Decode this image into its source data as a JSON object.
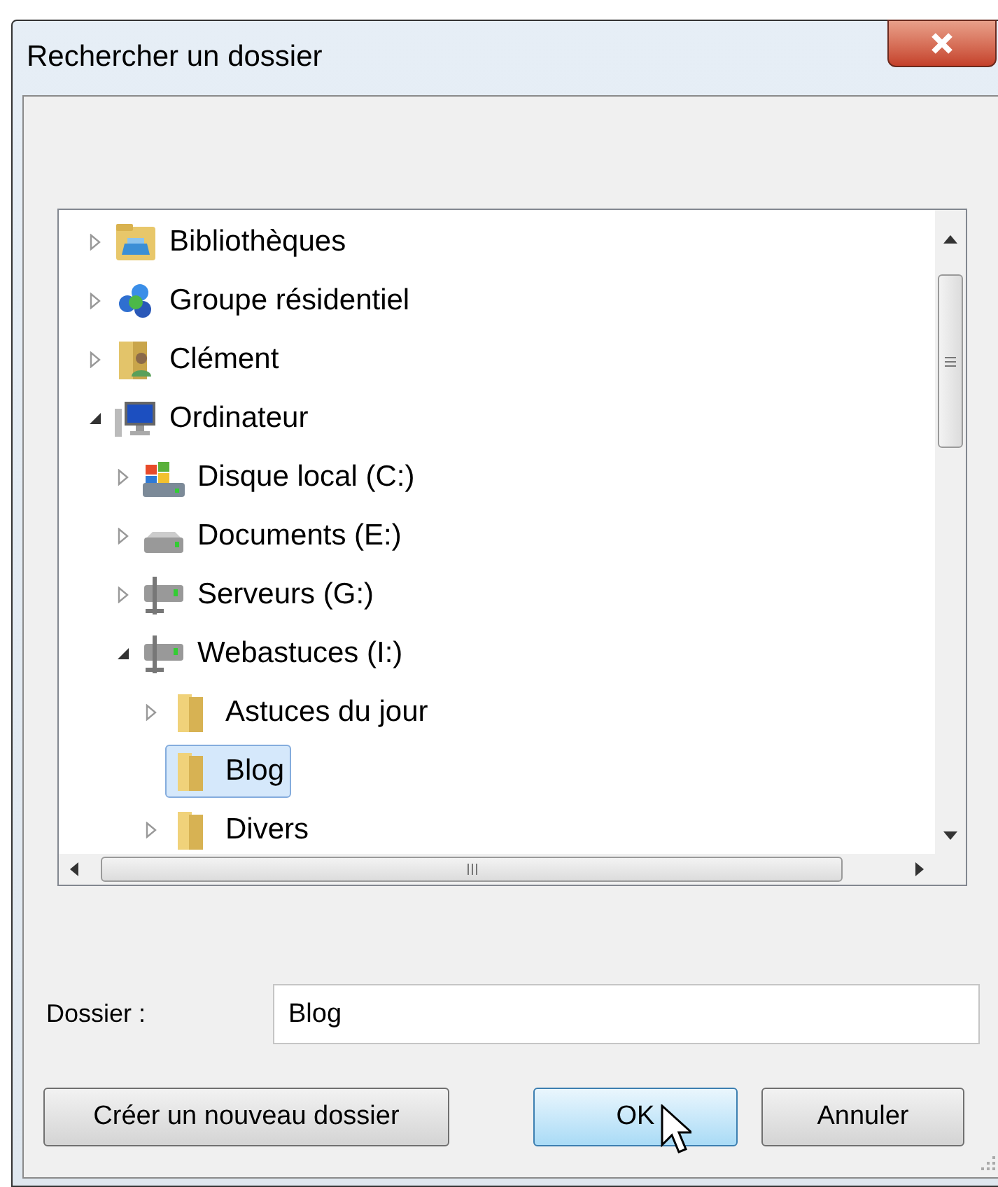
{
  "window": {
    "title": "Rechercher un dossier"
  },
  "tree": [
    {
      "label": "Bibliothèques",
      "kind": "library",
      "expandable": true,
      "expanded": false,
      "selected": false
    },
    {
      "label": "Groupe résidentiel",
      "kind": "homegroup",
      "expandable": true,
      "expanded": false,
      "selected": false
    },
    {
      "label": "Clément",
      "kind": "user",
      "expandable": true,
      "expanded": false,
      "selected": false
    },
    {
      "label": "Ordinateur",
      "kind": "computer",
      "expandable": true,
      "expanded": true,
      "selected": false,
      "children": [
        {
          "label": "Disque local (C:)",
          "kind": "system-drive",
          "expandable": true,
          "expanded": false,
          "selected": false
        },
        {
          "label": "Documents (E:)",
          "kind": "drive",
          "expandable": true,
          "expanded": false,
          "selected": false
        },
        {
          "label": "Serveurs (G:)",
          "kind": "network-drive",
          "expandable": true,
          "expanded": false,
          "selected": false
        },
        {
          "label": "Webastuces (I:)",
          "kind": "network-drive",
          "expandable": true,
          "expanded": true,
          "selected": false,
          "children": [
            {
              "label": "Astuces du jour",
              "kind": "folder",
              "expandable": true,
              "expanded": false,
              "selected": false
            },
            {
              "label": "Blog",
              "kind": "folder",
              "expandable": false,
              "selected": true
            },
            {
              "label": "Divers",
              "kind": "folder",
              "expandable": true,
              "expanded": false,
              "selected": false
            }
          ]
        }
      ]
    }
  ],
  "folder_field": {
    "label": "Dossier :",
    "value": "Blog"
  },
  "buttons": [
    {
      "label": "Créer un nouveau dossier",
      "kind": "normal"
    },
    {
      "label": "OK",
      "kind": "default"
    },
    {
      "label": "Annuler",
      "kind": "normal"
    }
  ]
}
